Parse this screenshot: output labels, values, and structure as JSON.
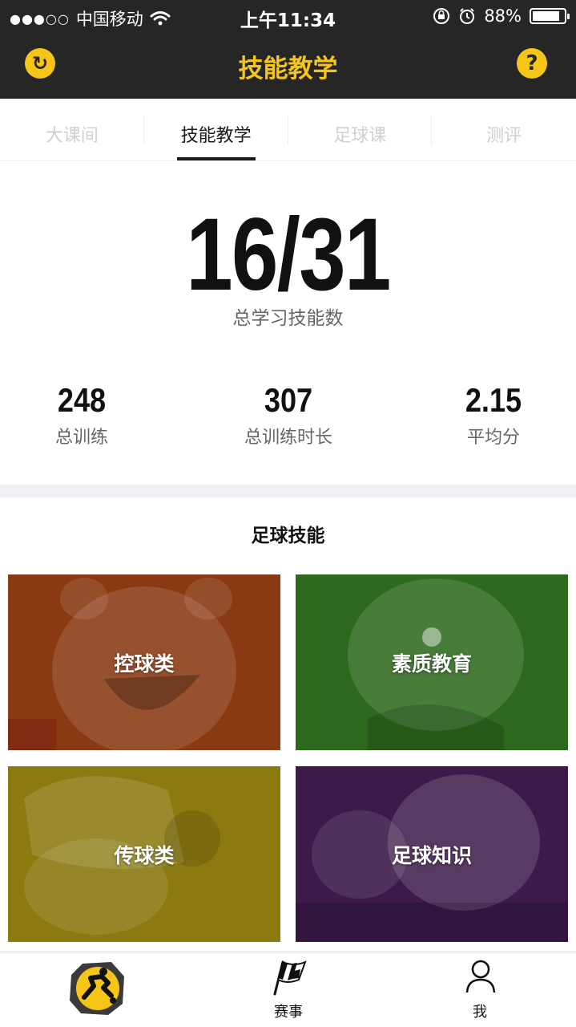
{
  "status_bar": {
    "signal": "●●●○○",
    "carrier": "中国移动",
    "time": "上午11:34",
    "battery": "88%",
    "battery_level": 0.88
  },
  "nav": {
    "title": "技能教学",
    "left_icon": "refresh-icon",
    "right_icon": "help-icon",
    "right_glyph": "?",
    "left_glyph": "↻"
  },
  "tabs": [
    {
      "label": "大课间",
      "active": false
    },
    {
      "label": "技能教学",
      "active": true
    },
    {
      "label": "足球课",
      "active": false
    },
    {
      "label": "测评",
      "active": false
    }
  ],
  "summary": {
    "learned": "16/31",
    "learned_label": "总学习技能数",
    "stats": [
      {
        "value": "248",
        "label": "总训练"
      },
      {
        "value": "307",
        "label": "总训练时长"
      },
      {
        "value": "2.15",
        "label": "平均分"
      }
    ]
  },
  "section": {
    "title": "足球技能"
  },
  "cards": [
    {
      "label": "控球类",
      "color": "#8a3a12"
    },
    {
      "label": "素质教育",
      "color": "#2e6a1e"
    },
    {
      "label": "传球类",
      "color": "#8a7a10"
    },
    {
      "label": "足球知识",
      "color": "#3d1a4a"
    }
  ],
  "bottom_tabs": [
    {
      "label": "",
      "icon": "player-logo-icon"
    },
    {
      "label": "赛事",
      "icon": "checkered-flag-icon"
    },
    {
      "label": "我",
      "icon": "user-icon"
    }
  ],
  "colors": {
    "accent": "#f5c518",
    "dark": "#262626"
  }
}
